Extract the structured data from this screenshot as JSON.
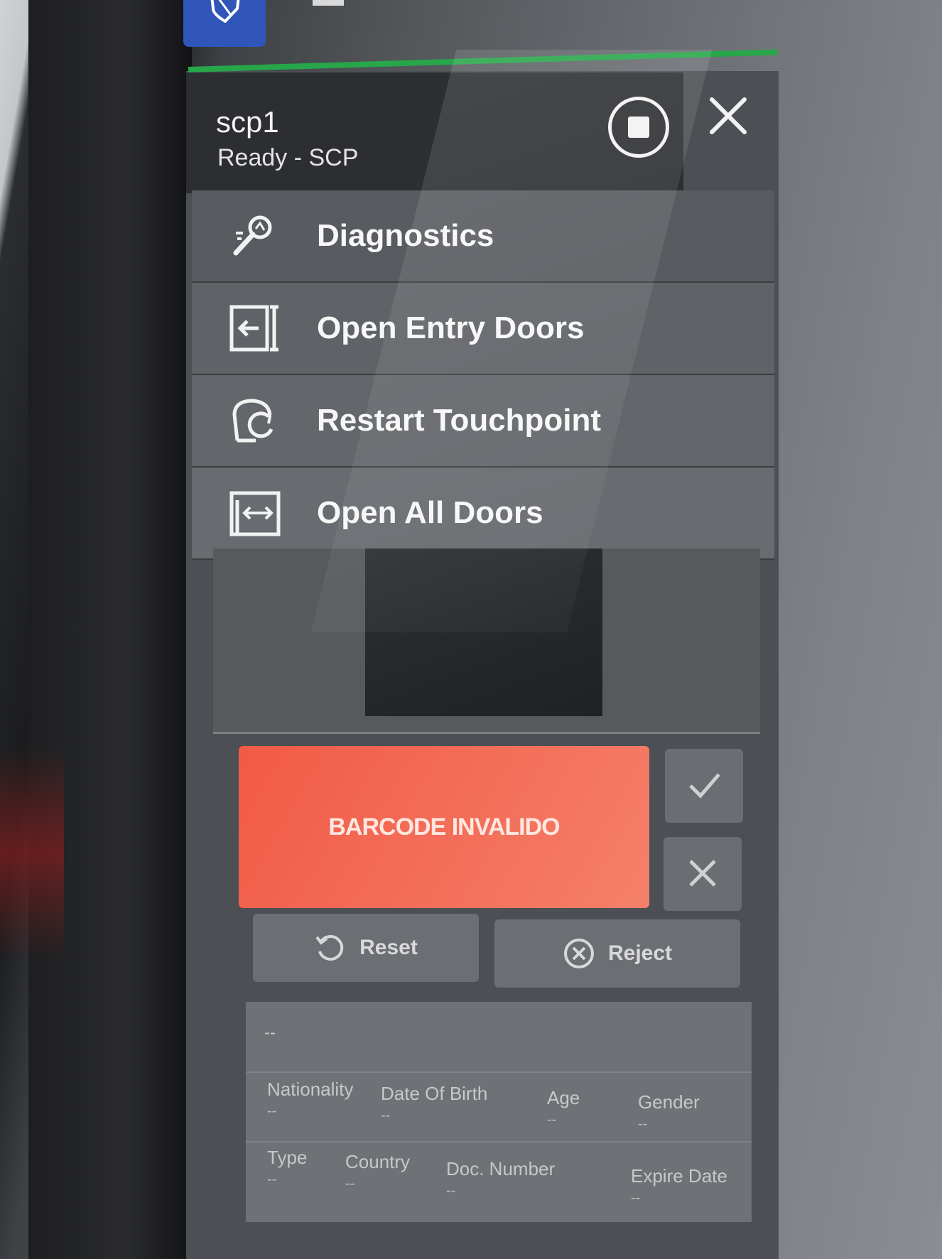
{
  "header": {
    "device_name": "scp1",
    "status": "Ready - SCP"
  },
  "menu": {
    "items": [
      {
        "label": "Diagnostics",
        "icon": "diagnostics-icon"
      },
      {
        "label": "Open Entry Doors",
        "icon": "door-entry-icon"
      },
      {
        "label": "Restart Touchpoint",
        "icon": "restart-icon"
      },
      {
        "label": "Open All Doors",
        "icon": "doors-both-icon"
      }
    ]
  },
  "result": {
    "message": "BARCODE INVALIDO"
  },
  "actions": {
    "reset_label": "Reset",
    "reject_label": "Reject"
  },
  "info": {
    "name_value": "--",
    "fields": [
      {
        "label": "Nationality",
        "value": "--"
      },
      {
        "label": "Date Of Birth",
        "value": "--"
      },
      {
        "label": "Age",
        "value": "--"
      },
      {
        "label": "Gender",
        "value": "--"
      },
      {
        "label": "Type",
        "value": "--"
      },
      {
        "label": "Country",
        "value": "--"
      },
      {
        "label": "Doc. Number",
        "value": "--"
      },
      {
        "label": "Expire Date",
        "value": "--"
      }
    ]
  },
  "colors": {
    "accent_green": "#27a64a",
    "error_banner": "#f25a46",
    "brand_blue": "#2f56b8"
  }
}
